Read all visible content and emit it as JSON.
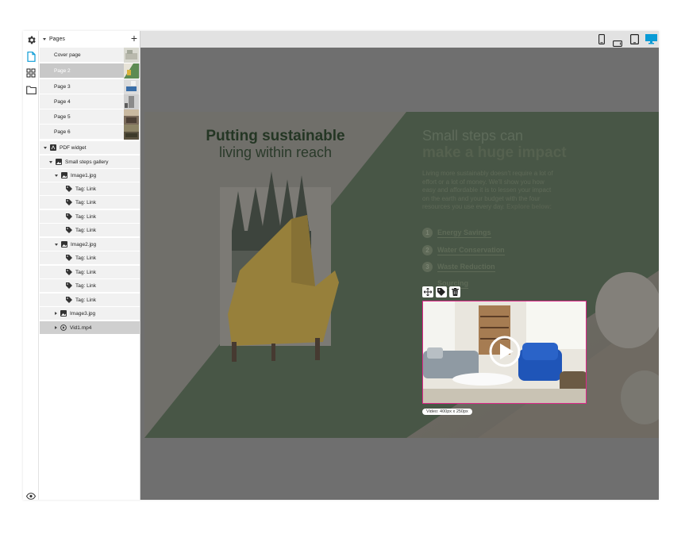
{
  "rail": {
    "icons": [
      "gear-icon",
      "page-icon",
      "grid-icon",
      "folder-icon",
      "eye-icon"
    ]
  },
  "pages_panel": {
    "title": "Pages",
    "add_symbol": "+",
    "pages": [
      {
        "label": "Cover page",
        "selected": false
      },
      {
        "label": "Page 2",
        "selected": true
      },
      {
        "label": "Page 3",
        "selected": false
      },
      {
        "label": "Page 4",
        "selected": false
      },
      {
        "label": "Page 5",
        "selected": false
      },
      {
        "label": "Page 6",
        "selected": false
      }
    ],
    "tree": {
      "widget": "PDF widget",
      "gallery": "Small steps gallery",
      "image1": "Image1.jpg",
      "image1_tags": [
        "Tag: Link",
        "Tag: Link",
        "Tag: Link",
        "Tag: Link"
      ],
      "image2": "Image2.jpg",
      "image2_tags": [
        "Tag: Link",
        "Tag: Link",
        "Tag: Link",
        "Tag: Link"
      ],
      "image3": "Image3.jpg",
      "video": "Vid1.mp4"
    }
  },
  "devices": [
    "phone-portrait-icon",
    "phone-landscape-icon",
    "tablet-icon",
    "desktop-icon"
  ],
  "hero": {
    "headline_bold": "Putting sustainable",
    "headline_light": "living within reach",
    "sub_light": "Small steps can",
    "sub_bold": "make a huge impact",
    "body": "Living more sustainably doesn't require a lot of effort or a lot of money. We'll show you how easy and affordable it is to lessen your impact on the earth and your budget with the four resources you use every day.",
    "body_bold": "Explore below:",
    "list": [
      {
        "num": "1",
        "label": "Energy Savings"
      },
      {
        "num": "2",
        "label": "Water Conservation"
      },
      {
        "num": "3",
        "label": "Waste Reduction"
      },
      {
        "num": "4",
        "label": "Sourcing"
      }
    ]
  },
  "widget": {
    "tools": [
      "move-icon",
      "tag-icon",
      "trash-icon"
    ],
    "size_label": "Video: 400px x 250px"
  },
  "colors": {
    "selection_outline": "#e0288a",
    "active_device": "#0a9bd6",
    "hero_green": "#3d553b"
  }
}
